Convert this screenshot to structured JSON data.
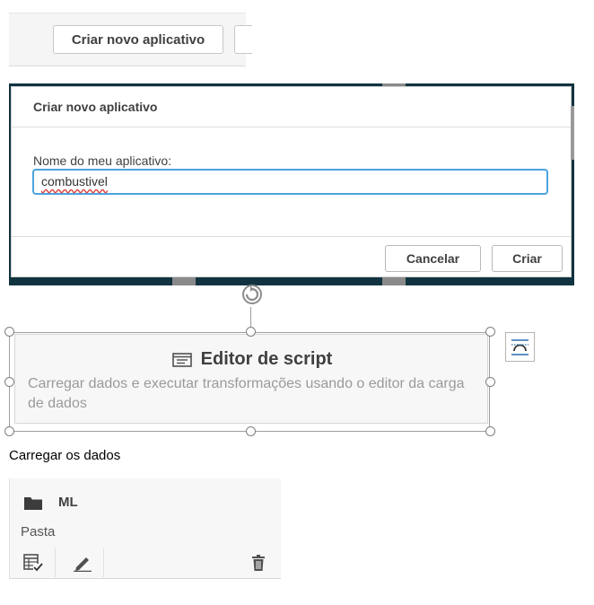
{
  "toolbar": {
    "create_app_label": "Criar novo aplicativo"
  },
  "dialog": {
    "title": "Criar novo aplicativo",
    "name_label": "Nome do meu aplicativo:",
    "name_value": "combustivel",
    "cancel_label": "Cancelar",
    "create_label": "Criar"
  },
  "card": {
    "title": "Editor de script",
    "description": "Carregar dados e executar transformações usando o editor da carga de dados",
    "icon": "script-editor-icon"
  },
  "caption": "Carregar os dados",
  "folder": {
    "name": "ML",
    "type": "Pasta",
    "icon": "folder-icon",
    "actions": [
      "table-check-icon",
      "edit-pencil-icon",
      "trash-icon"
    ]
  },
  "colors": {
    "input_focus": "#4aa3df",
    "backdrop": "#113340",
    "text": "#404040"
  }
}
